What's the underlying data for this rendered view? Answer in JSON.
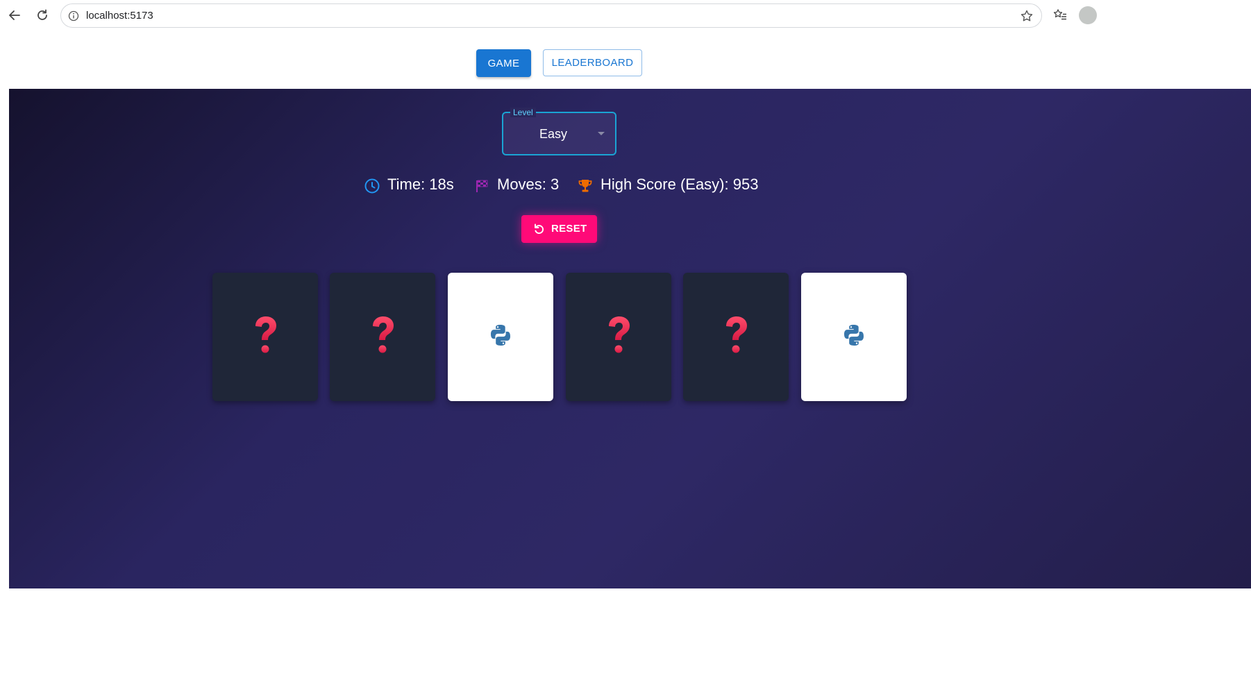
{
  "browser": {
    "url": "localhost:5173",
    "icons": [
      "back-arrow-icon",
      "reload-icon",
      "info-icon",
      "star-icon",
      "favorites-list-icon",
      "profile-avatar"
    ]
  },
  "nav": {
    "game_label": "GAME",
    "leaderboard_label": "LEADERBOARD"
  },
  "level": {
    "label": "Level",
    "value": "Easy"
  },
  "stats": {
    "time": "Time: 18s",
    "moves": "Moves: 3",
    "high_score": "High Score (Easy): 953",
    "icons": [
      "clock-icon",
      "checkered-flag-icon",
      "trophy-icon"
    ]
  },
  "reset": {
    "label": "RESET",
    "icon": "restart-icon"
  },
  "cards": [
    {
      "state": "face-down",
      "symbol": "question-mark"
    },
    {
      "state": "face-down",
      "symbol": "question-mark"
    },
    {
      "state": "face-up",
      "symbol": "python-logo"
    },
    {
      "state": "face-down",
      "symbol": "question-mark"
    },
    {
      "state": "face-down",
      "symbol": "question-mark"
    },
    {
      "state": "face-up",
      "symbol": "python-logo"
    }
  ],
  "colors": {
    "primary": "#1976d2",
    "reset": "#ff0a78",
    "card_back": "#1f2638",
    "question_mark": "#e8284f",
    "python_blue": "#3776ab"
  }
}
